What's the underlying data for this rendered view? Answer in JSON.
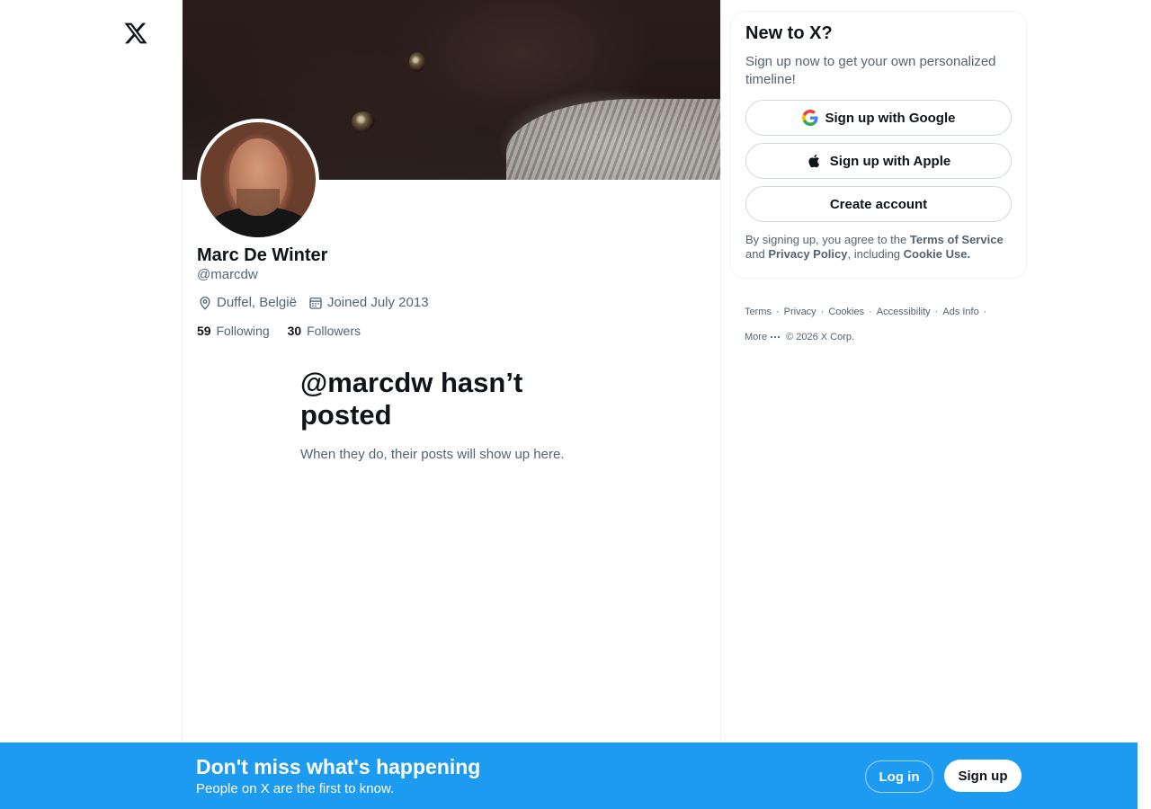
{
  "brand": {
    "logo_icon": "x-logo-icon"
  },
  "profile": {
    "name": "Marc De Winter",
    "handle": "@marcdw",
    "location": "Duffel, België",
    "joined": "Joined July 2013",
    "following_count": "59",
    "following_label": "Following",
    "followers_count": "30",
    "followers_label": "Followers"
  },
  "empty_state": {
    "title": "@marcdw hasn’t posted",
    "subtitle": "When they do, their posts will show up here."
  },
  "signup_card": {
    "heading": "New to X?",
    "description": "Sign up now to get your own personalized timeline!",
    "google_label": "Sign up with Google",
    "apple_label": "Sign up with Apple",
    "create_label": "Create account",
    "legal_prefix": "By signing up, you agree to the ",
    "terms_link": "Terms of Service",
    "legal_and": " and ",
    "privacy_link": "Privacy Policy",
    "legal_including": ", including ",
    "cookie_link": "Cookie Use."
  },
  "footer": {
    "terms": "Terms",
    "privacy": "Privacy",
    "cookies": "Cookies",
    "accessibility": "Accessibility",
    "ads_info": "Ads Info",
    "more": "More",
    "copyright": "© 2026 X Corp.",
    "separator": "·"
  },
  "bottom_bar": {
    "title": "Don't miss what's happening",
    "subtitle": "People on X are the first to know.",
    "login_label": "Log in",
    "signup_label": "Sign up"
  },
  "colors": {
    "accent": "#1d9bf0",
    "text_primary": "#0f1419",
    "text_secondary": "#536471",
    "border": "#eff3f4"
  }
}
